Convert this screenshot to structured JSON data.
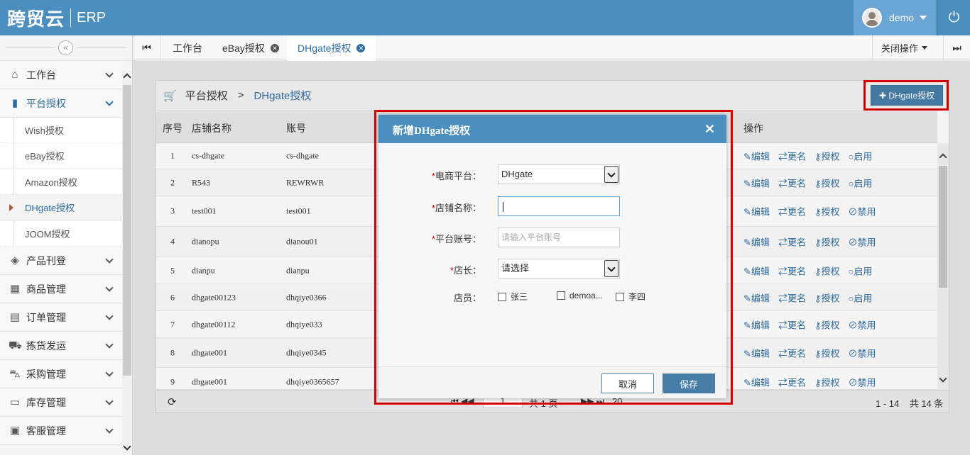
{
  "header": {
    "brand": "跨贸云",
    "product": "ERP",
    "user": "demo"
  },
  "sidebar": {
    "items": [
      {
        "label": "工作台",
        "icon": "home-icon"
      },
      {
        "label": "平台授权",
        "icon": "bookmark-icon"
      },
      {
        "label": "产品刊登",
        "icon": "box-icon"
      },
      {
        "label": "商品管理",
        "icon": "gift-icon"
      },
      {
        "label": "订单管理",
        "icon": "file-icon"
      },
      {
        "label": "拣货发运",
        "icon": "truck-icon"
      },
      {
        "label": "采购管理",
        "icon": "cart-icon"
      },
      {
        "label": "库存管理",
        "icon": "inbox-icon"
      },
      {
        "label": "客服管理",
        "icon": "briefcase-icon"
      }
    ],
    "subitems": [
      "Wish授权",
      "eBay授权",
      "Amazon授权",
      "DHgate授权",
      "JOOM授权"
    ]
  },
  "tabs": {
    "items": [
      "工作台",
      "eBay授权",
      "DHgate授权"
    ],
    "close_ops": "关闭操作"
  },
  "breadcrumb": {
    "parent": "平台授权",
    "sep": ">",
    "current": "DHgate授权"
  },
  "add_button": "✚ DHgate授权",
  "table": {
    "headers": {
      "seq": "序号",
      "shop": "店铺名称",
      "account": "账号",
      "ops": "操作"
    },
    "rows": [
      {
        "seq": "1",
        "shop": "cs-dhgate",
        "account": "cs-dhgate",
        "toggle": "启用"
      },
      {
        "seq": "2",
        "shop": "R543",
        "account": "REWRWR",
        "toggle": "启用"
      },
      {
        "seq": "3",
        "shop": "test001",
        "account": "test001",
        "toggle": "禁用"
      },
      {
        "seq": "4",
        "shop": "dianopu",
        "account": "dianou01",
        "toggle": "禁用"
      },
      {
        "seq": "5",
        "shop": "dianpu",
        "account": "dianpu",
        "toggle": "启用"
      },
      {
        "seq": "6",
        "shop": "dhgate00123",
        "account": "dhqiye0366",
        "toggle": "启用"
      },
      {
        "seq": "7",
        "shop": "dhgate00112",
        "account": "dhqiye033",
        "toggle": "禁用"
      },
      {
        "seq": "8",
        "shop": "dhgate001",
        "account": "dhqiye0345",
        "toggle": "禁用"
      },
      {
        "seq": "9",
        "shop": "dhgate001",
        "account": "dhqiye0365657",
        "toggle": "禁用"
      }
    ],
    "op_labels": {
      "edit": "编辑",
      "rename": "更名",
      "auth": "授权"
    }
  },
  "pager": {
    "page": "1",
    "total_pages": "共 1 页",
    "page_size": "20",
    "range": "1 - 14",
    "total": "共 14 条"
  },
  "dialog": {
    "title": "新增DHgate授权",
    "fields": {
      "platform_label": "电商平台：",
      "platform_value": "DHgate",
      "shop_label": "店铺名称：",
      "shop_value": "",
      "account_label": "平台账号：",
      "account_placeholder": "请输入平台账号",
      "manager_label": "店长：",
      "manager_value": "请选择",
      "staff_label": "店员："
    },
    "staff": [
      "张三",
      "demoa...",
      "李四"
    ],
    "cancel": "取消",
    "save": "保存"
  }
}
